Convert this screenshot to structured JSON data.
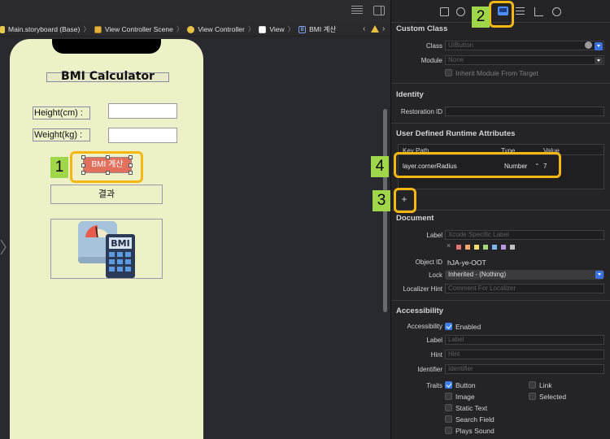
{
  "breadcrumb": [
    "Main.storyboard (Base)",
    "View Controller Scene",
    "View Controller",
    "View",
    "BMI 계산"
  ],
  "app": {
    "title": "BMI Calculator",
    "height_label": "Height(cm) :",
    "weight_label": "Weight(kg) :",
    "bmi_button_label": "BMI 계산",
    "result_label": "결과",
    "image_badge_text": "BMI"
  },
  "callouts": [
    "1",
    "2",
    "3",
    "4"
  ],
  "inspector": {
    "custom_class": {
      "title": "Custom Class",
      "class_label": "Class",
      "class_value": "UIButton",
      "module_label": "Module",
      "module_value": "None",
      "inherit_label": "Inherit Module From Target"
    },
    "identity": {
      "title": "Identity",
      "restoration_id_label": "Restoration ID"
    },
    "runtime_attributes": {
      "title": "User Defined Runtime Attributes",
      "columns": [
        "Key Path",
        "Type",
        "Value"
      ],
      "row": {
        "key_path": "layer.cornerRadius",
        "type": "Number",
        "value": "7"
      },
      "add_symbol": "+"
    },
    "document": {
      "title": "Document",
      "label_label": "Label",
      "label_placeholder": "Xcode Specific Label",
      "swatch_clear": "×",
      "swatch_colors": [
        "#e57373",
        "#f3a66a",
        "#f0dc6c",
        "#a5d67a",
        "#7fb8ef",
        "#b59ae6",
        "#bfbfbf"
      ],
      "object_id_label": "Object ID",
      "object_id_value": "hJA-ye-OOT",
      "lock_label": "Lock",
      "lock_value": "Inherited - (Nothing)",
      "localizer_hint_label": "Localizer Hint",
      "localizer_hint_placeholder": "Comment For Localizer"
    },
    "accessibility": {
      "title": "Accessibility",
      "accessibility_label": "Accessibility",
      "enabled_label": "Enabled",
      "label_label": "Label",
      "label_placeholder": "Label",
      "hint_label": "Hint",
      "hint_placeholder": "Hint",
      "identifier_label": "Identifier",
      "identifier_placeholder": "Identifier",
      "traits_label": "Traits",
      "traits": [
        {
          "name": "Button",
          "checked": true
        },
        {
          "name": "Link",
          "checked": false
        },
        {
          "name": "Image",
          "checked": false
        },
        {
          "name": "Selected",
          "checked": false
        },
        {
          "name": "Static Text",
          "checked": false
        },
        {
          "name": "Search Field",
          "checked": false
        },
        {
          "name": "Plays Sound",
          "checked": false
        }
      ]
    }
  },
  "colors": {
    "accent_blue": "#3a7ff0",
    "callout_green": "#9fd64a",
    "callout_yellow": "#f5b812",
    "phone_background": "#eef0c8",
    "button_red": "#e1705f"
  }
}
